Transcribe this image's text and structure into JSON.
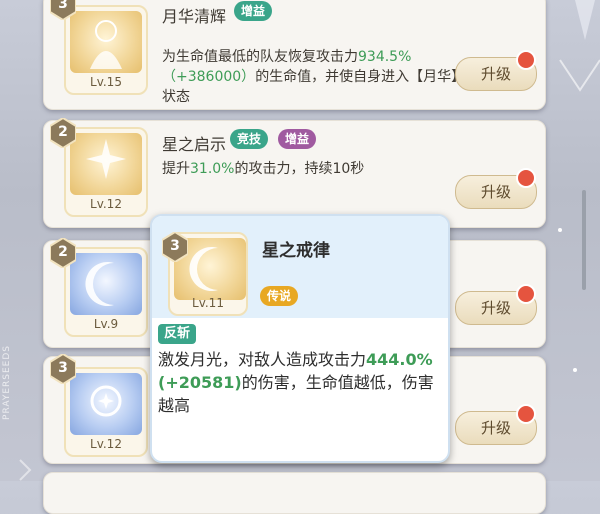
{
  "skills": [
    {
      "level_badge": "3",
      "title": "月华清辉",
      "tags": [
        {
          "label": "增益",
          "color": "#3aa58a"
        }
      ],
      "icon": "praying-goddess-icon",
      "icon_tone": "gold",
      "lv": "Lv.15",
      "desc_parts": [
        "为生命值最低的队友恢复攻击力",
        "934.5%（+386000）",
        "的生命值，并使自身进入【月华】状态"
      ],
      "upgrade_label": "升级"
    },
    {
      "level_badge": "2",
      "title": "星之启示",
      "tags": [
        {
          "label": "竞技",
          "color": "#3aa58a"
        },
        {
          "label": "增益",
          "color": "#a05aa0"
        }
      ],
      "icon": "star-ship-icon",
      "icon_tone": "gold",
      "lv": "Lv.12",
      "desc_parts": [
        "提升",
        "31.0%",
        "的攻击力，持续10秒"
      ],
      "upgrade_label": "升级"
    },
    {
      "level_badge": "2",
      "title": "",
      "tags": [],
      "icon": "crescent-moon-icon",
      "icon_tone": "blue",
      "lv": "Lv.9",
      "desc_parts": [
        "",
        "",
        ""
      ],
      "upgrade_label": "升级"
    },
    {
      "level_badge": "3",
      "title": "",
      "tags": [],
      "icon": "moon-star-icon",
      "icon_tone": "blue",
      "lv": "Lv.12",
      "desc_parts": [
        "",
        "",
        ""
      ],
      "upgrade_label": "升级"
    }
  ],
  "popup": {
    "level_badge": "3",
    "title": "星之戒律",
    "lv": "Lv.11",
    "rarity_tag": "传说",
    "type_tag": "反斩",
    "desc_parts": [
      "激发月光，对敌人造成攻击力",
      "444.0%(+20581)",
      "的伤害，生命值越低，伤害越高"
    ]
  },
  "side_label": "PRAYERSEEDS"
}
